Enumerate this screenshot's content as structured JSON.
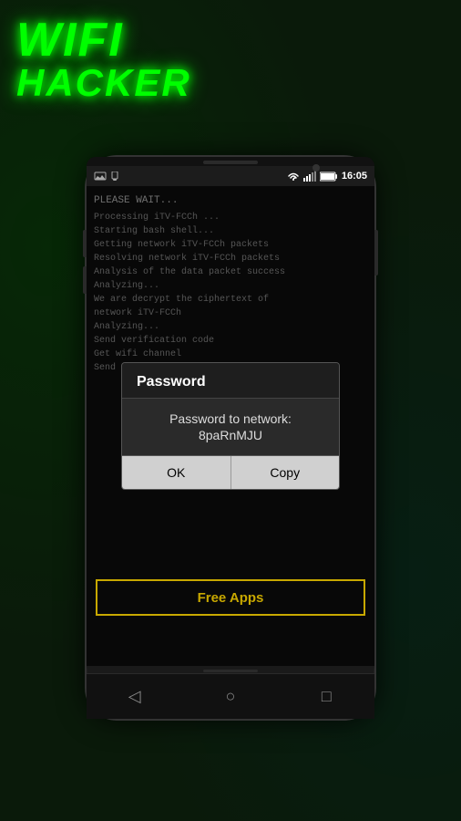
{
  "title": {
    "wifi": "WIFI",
    "hacker": "HACKER"
  },
  "status_bar": {
    "time": "16:05",
    "icons": [
      "notification1",
      "notification2",
      "wifi",
      "signal",
      "battery"
    ]
  },
  "terminal": {
    "please_wait": "PLEASE WAIT...",
    "lines": [
      "Processing iTV-FCCh ...",
      "Starting bash shell...",
      "Getting network iTV-FCCh packets",
      "Resolving network iTV-FCCh packets",
      "Analysis of the data packet success",
      "Analyzing...",
      "We are decrypt the ciphertext of",
      "network iTV-FCCh",
      "Analyzing...",
      "Send verification code",
      "Get wifi channel",
      "Send Authorization Code"
    ]
  },
  "dialog": {
    "title": "Password",
    "message": "Password to network: 8paRnMJU",
    "ok_label": "OK",
    "copy_label": "Copy"
  },
  "banner": {
    "label": "Free Apps"
  },
  "nav": {
    "back_label": "◁",
    "home_label": "○",
    "recent_label": "□"
  }
}
